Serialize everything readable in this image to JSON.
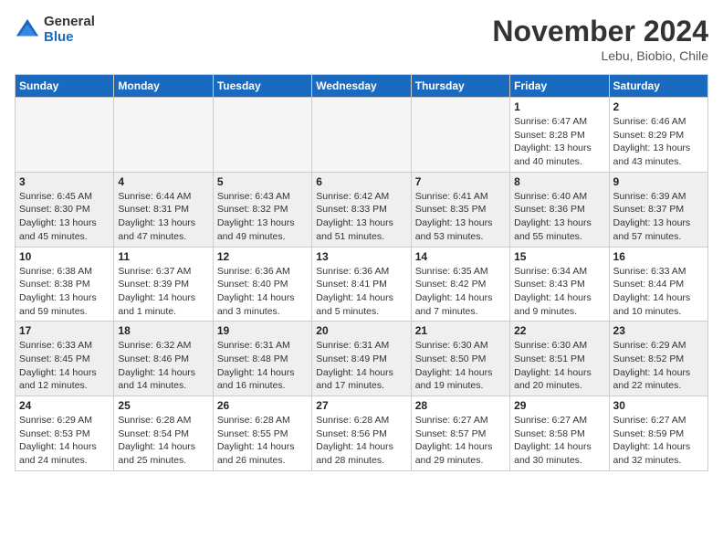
{
  "logo": {
    "general": "General",
    "blue": "Blue"
  },
  "header": {
    "month": "November 2024",
    "location": "Lebu, Biobio, Chile"
  },
  "weekdays": [
    "Sunday",
    "Monday",
    "Tuesday",
    "Wednesday",
    "Thursday",
    "Friday",
    "Saturday"
  ],
  "weeks": [
    [
      {
        "day": "",
        "info": ""
      },
      {
        "day": "",
        "info": ""
      },
      {
        "day": "",
        "info": ""
      },
      {
        "day": "",
        "info": ""
      },
      {
        "day": "",
        "info": ""
      },
      {
        "day": "1",
        "info": "Sunrise: 6:47 AM\nSunset: 8:28 PM\nDaylight: 13 hours\nand 40 minutes."
      },
      {
        "day": "2",
        "info": "Sunrise: 6:46 AM\nSunset: 8:29 PM\nDaylight: 13 hours\nand 43 minutes."
      }
    ],
    [
      {
        "day": "3",
        "info": "Sunrise: 6:45 AM\nSunset: 8:30 PM\nDaylight: 13 hours\nand 45 minutes."
      },
      {
        "day": "4",
        "info": "Sunrise: 6:44 AM\nSunset: 8:31 PM\nDaylight: 13 hours\nand 47 minutes."
      },
      {
        "day": "5",
        "info": "Sunrise: 6:43 AM\nSunset: 8:32 PM\nDaylight: 13 hours\nand 49 minutes."
      },
      {
        "day": "6",
        "info": "Sunrise: 6:42 AM\nSunset: 8:33 PM\nDaylight: 13 hours\nand 51 minutes."
      },
      {
        "day": "7",
        "info": "Sunrise: 6:41 AM\nSunset: 8:35 PM\nDaylight: 13 hours\nand 53 minutes."
      },
      {
        "day": "8",
        "info": "Sunrise: 6:40 AM\nSunset: 8:36 PM\nDaylight: 13 hours\nand 55 minutes."
      },
      {
        "day": "9",
        "info": "Sunrise: 6:39 AM\nSunset: 8:37 PM\nDaylight: 13 hours\nand 57 minutes."
      }
    ],
    [
      {
        "day": "10",
        "info": "Sunrise: 6:38 AM\nSunset: 8:38 PM\nDaylight: 13 hours\nand 59 minutes."
      },
      {
        "day": "11",
        "info": "Sunrise: 6:37 AM\nSunset: 8:39 PM\nDaylight: 14 hours\nand 1 minute."
      },
      {
        "day": "12",
        "info": "Sunrise: 6:36 AM\nSunset: 8:40 PM\nDaylight: 14 hours\nand 3 minutes."
      },
      {
        "day": "13",
        "info": "Sunrise: 6:36 AM\nSunset: 8:41 PM\nDaylight: 14 hours\nand 5 minutes."
      },
      {
        "day": "14",
        "info": "Sunrise: 6:35 AM\nSunset: 8:42 PM\nDaylight: 14 hours\nand 7 minutes."
      },
      {
        "day": "15",
        "info": "Sunrise: 6:34 AM\nSunset: 8:43 PM\nDaylight: 14 hours\nand 9 minutes."
      },
      {
        "day": "16",
        "info": "Sunrise: 6:33 AM\nSunset: 8:44 PM\nDaylight: 14 hours\nand 10 minutes."
      }
    ],
    [
      {
        "day": "17",
        "info": "Sunrise: 6:33 AM\nSunset: 8:45 PM\nDaylight: 14 hours\nand 12 minutes."
      },
      {
        "day": "18",
        "info": "Sunrise: 6:32 AM\nSunset: 8:46 PM\nDaylight: 14 hours\nand 14 minutes."
      },
      {
        "day": "19",
        "info": "Sunrise: 6:31 AM\nSunset: 8:48 PM\nDaylight: 14 hours\nand 16 minutes."
      },
      {
        "day": "20",
        "info": "Sunrise: 6:31 AM\nSunset: 8:49 PM\nDaylight: 14 hours\nand 17 minutes."
      },
      {
        "day": "21",
        "info": "Sunrise: 6:30 AM\nSunset: 8:50 PM\nDaylight: 14 hours\nand 19 minutes."
      },
      {
        "day": "22",
        "info": "Sunrise: 6:30 AM\nSunset: 8:51 PM\nDaylight: 14 hours\nand 20 minutes."
      },
      {
        "day": "23",
        "info": "Sunrise: 6:29 AM\nSunset: 8:52 PM\nDaylight: 14 hours\nand 22 minutes."
      }
    ],
    [
      {
        "day": "24",
        "info": "Sunrise: 6:29 AM\nSunset: 8:53 PM\nDaylight: 14 hours\nand 24 minutes."
      },
      {
        "day": "25",
        "info": "Sunrise: 6:28 AM\nSunset: 8:54 PM\nDaylight: 14 hours\nand 25 minutes."
      },
      {
        "day": "26",
        "info": "Sunrise: 6:28 AM\nSunset: 8:55 PM\nDaylight: 14 hours\nand 26 minutes."
      },
      {
        "day": "27",
        "info": "Sunrise: 6:28 AM\nSunset: 8:56 PM\nDaylight: 14 hours\nand 28 minutes."
      },
      {
        "day": "28",
        "info": "Sunrise: 6:27 AM\nSunset: 8:57 PM\nDaylight: 14 hours\nand 29 minutes."
      },
      {
        "day": "29",
        "info": "Sunrise: 6:27 AM\nSunset: 8:58 PM\nDaylight: 14 hours\nand 30 minutes."
      },
      {
        "day": "30",
        "info": "Sunrise: 6:27 AM\nSunset: 8:59 PM\nDaylight: 14 hours\nand 32 minutes."
      }
    ]
  ]
}
